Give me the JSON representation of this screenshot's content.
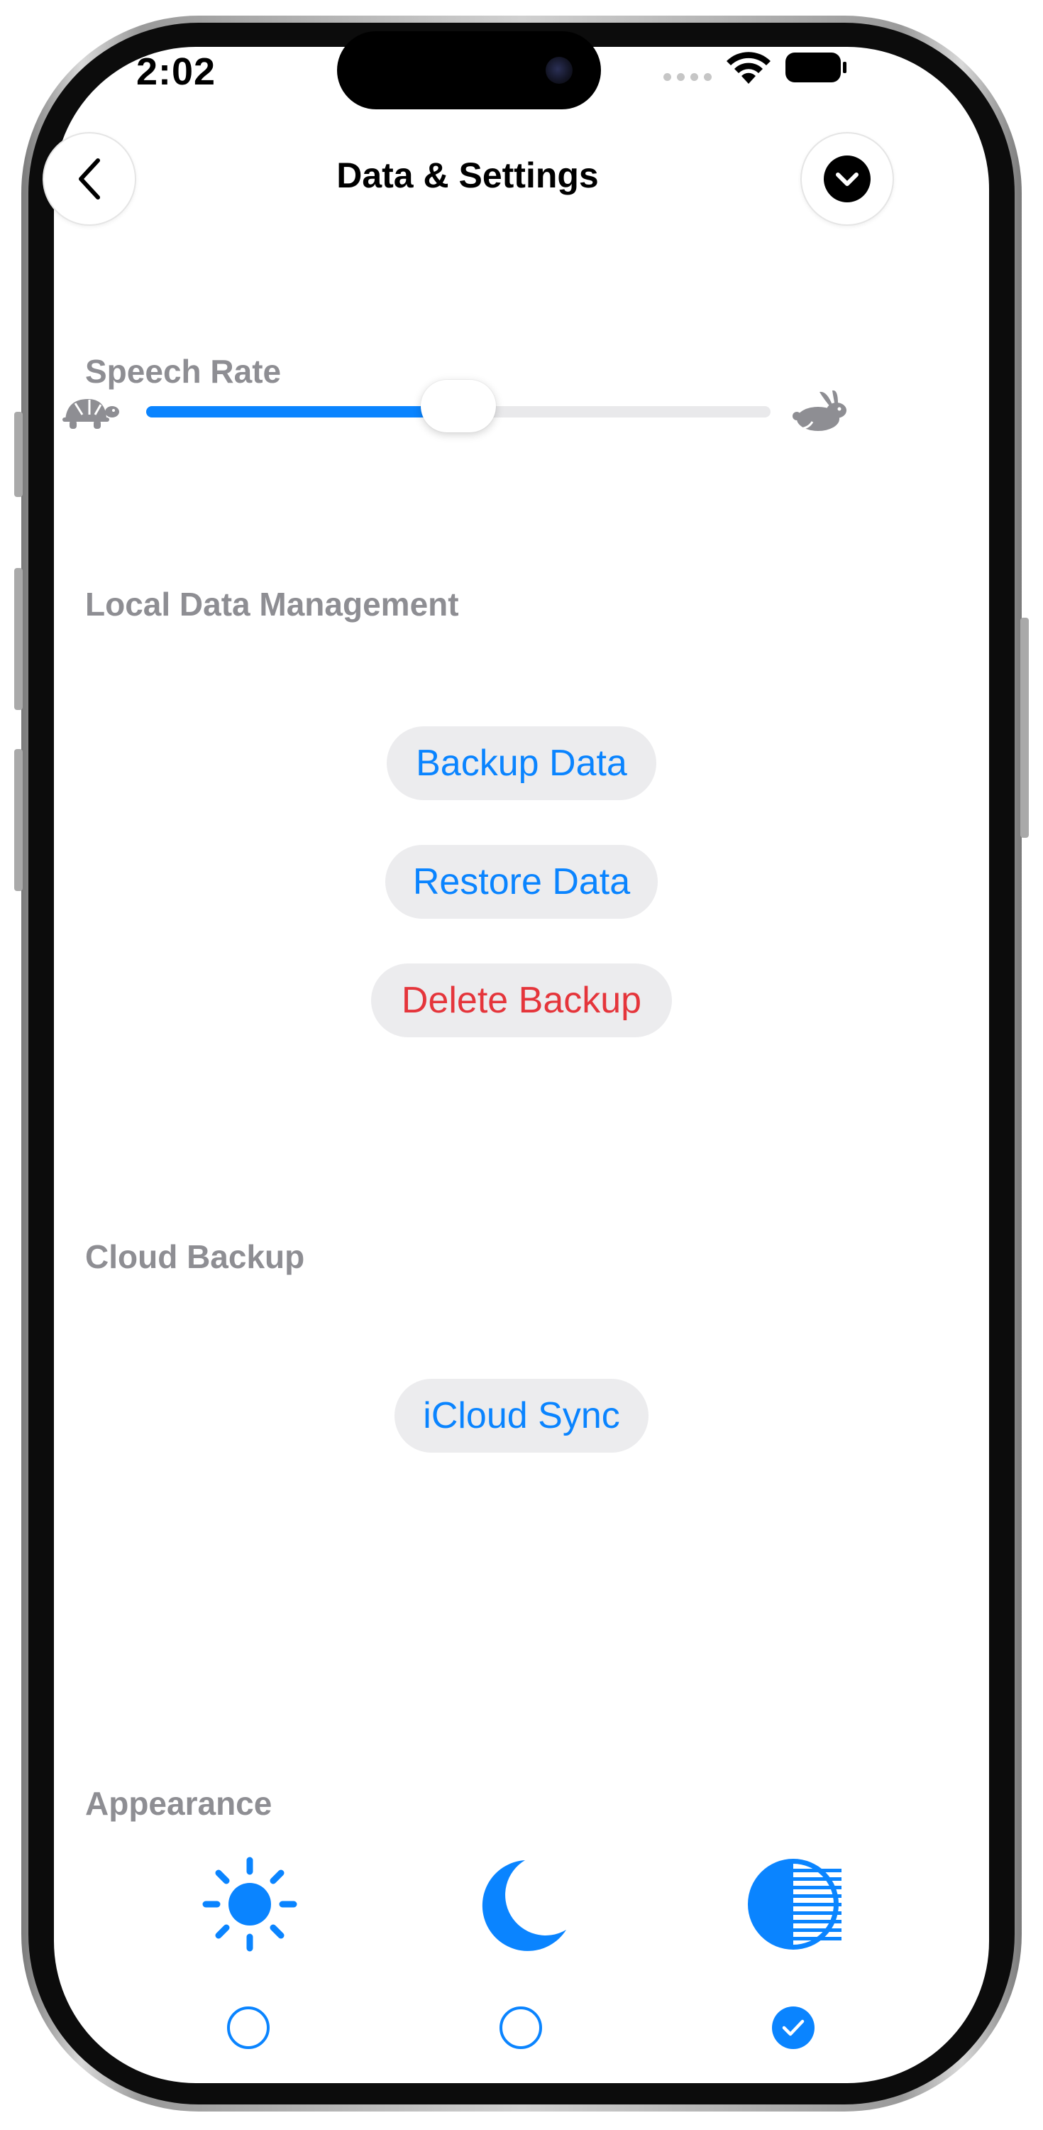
{
  "status_bar": {
    "time": "2:02"
  },
  "header": {
    "title": "Data & Settings",
    "back_icon": "chevron-left-icon",
    "menu_icon": "chevron-down-circle-icon"
  },
  "speech_rate": {
    "label": "Speech Rate",
    "value_fraction": 0.5,
    "min_icon": "tortoise-icon",
    "max_icon": "hare-icon"
  },
  "local_data": {
    "label": "Local Data Management",
    "buttons": [
      {
        "label": "Backup Data",
        "color": "#0a84ff"
      },
      {
        "label": "Restore Data",
        "color": "#0a84ff"
      },
      {
        "label": "Delete Backup",
        "color": "#e5353b"
      }
    ]
  },
  "cloud_backup": {
    "label": "Cloud Backup",
    "button": {
      "label": "iCloud Sync",
      "color": "#0a84ff"
    }
  },
  "appearance": {
    "label": "Appearance",
    "options": [
      {
        "icon": "sun-icon",
        "selected": false
      },
      {
        "icon": "moon-icon",
        "selected": false
      },
      {
        "icon": "half-contrast-icon",
        "selected": true
      }
    ]
  },
  "colors": {
    "accent": "#0a84ff",
    "destructive": "#e5353b",
    "section_label": "#8e8e93",
    "pill_background": "#ececee"
  }
}
